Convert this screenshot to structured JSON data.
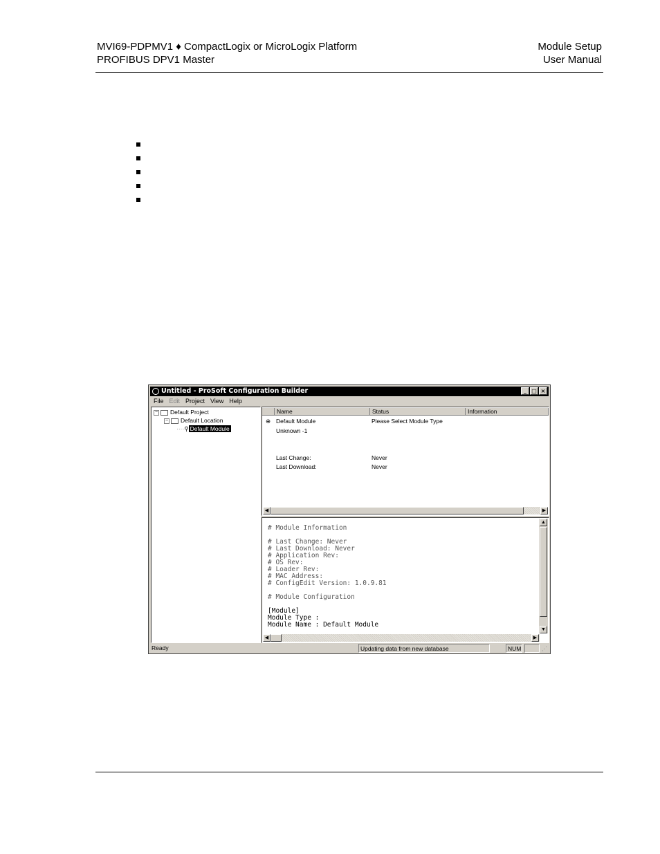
{
  "header": {
    "left_line1": "MVI69-PDPMV1 ♦ CompactLogix or MicroLogix Platform",
    "left_line2": "PROFIBUS DPV1 Master",
    "right_line1": "Module Setup",
    "right_line2": "User Manual"
  },
  "bullets_count": 5,
  "window": {
    "title": "Untitled - ProSoft Configuration Builder",
    "buttons": [
      "_",
      "□",
      "×"
    ],
    "menu": [
      "File",
      "Edit",
      "Project",
      "View",
      "Help"
    ],
    "tree": {
      "project": "Default Project",
      "location": "Default Location",
      "module": "Default Module"
    },
    "grid": {
      "columns": [
        "Name",
        "Status",
        "Information"
      ],
      "rows": [
        [
          "Default Module",
          "Please Select Module Type"
        ],
        [
          "Unknown -1",
          ""
        ],
        [
          "Last Change:",
          "Never"
        ],
        [
          "Last Download:",
          "Never"
        ]
      ]
    },
    "text_lines": [
      "# Module Information",
      "",
      "# Last Change: Never",
      "# Last Download: Never",
      "# Application Rev:",
      "# OS Rev:",
      "# Loader Rev:",
      "# MAC Address:",
      "# ConfigEdit Version: 1.0.9.81",
      "",
      "# Module Configuration",
      "",
      "[Module]",
      "Module Type :",
      "Module Name : Default Module"
    ],
    "status": {
      "left": "Ready",
      "middle": "Updating data from new database",
      "num": "NUM"
    }
  }
}
